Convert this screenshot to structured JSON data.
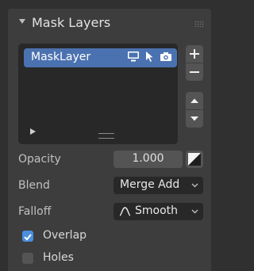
{
  "panel": {
    "title": "Mask Layers"
  },
  "layers": [
    {
      "name": "MaskLayer"
    }
  ],
  "fields": {
    "opacity_label": "Opacity",
    "opacity_value": "1.000",
    "blend_label": "Blend",
    "blend_value": "Merge Add",
    "falloff_label": "Falloff",
    "falloff_value": "Smooth"
  },
  "options": {
    "overlap_label": "Overlap",
    "overlap_checked": true,
    "holes_label": "Holes",
    "holes_checked": false
  },
  "colors": {
    "selection": "#4b72b0",
    "checkbox_on": "#4b8fde",
    "panel_bg": "#3d3d3d",
    "window_bg": "#303030"
  },
  "icons": [
    "disclosure-triangle-icon",
    "drag-grip-icon",
    "monitor-icon",
    "cursor-arrow-icon",
    "camera-icon",
    "play-icon",
    "resize-handle-icon",
    "plus-icon",
    "minus-icon",
    "arrow-up-icon",
    "arrow-down-icon",
    "gradient-icon",
    "chevron-down-icon",
    "smooth-falloff-icon",
    "checkmark-icon"
  ]
}
